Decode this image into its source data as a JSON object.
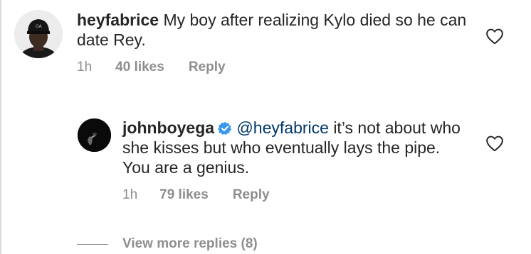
{
  "comment": {
    "username": "heyfabrice",
    "text": "My boy after realizing Kylo died so he can date Rey.",
    "time": "1h",
    "likes": "40 likes",
    "reply_label": "Reply",
    "avatar_icon": "profile-avatar-icon",
    "like_icon": "heart-outline-icon"
  },
  "reply": {
    "username": "johnboyega",
    "verified": true,
    "verified_icon": "verified-badge-icon",
    "verified_color": "#3897f0",
    "mention": "@heyfabrice",
    "text": "it’s not about who she kisses but who eventually lays the pipe. You are a genius.",
    "time": "1h",
    "likes": "79 likes",
    "reply_label": "Reply",
    "avatar_icon": "profile-avatar-icon",
    "like_icon": "heart-outline-icon"
  },
  "view_more": {
    "label": "View more replies (8)"
  },
  "colors": {
    "text": "#262626",
    "meta": "#8e8e8e",
    "mention": "#00376b",
    "background": "#ffffff"
  }
}
